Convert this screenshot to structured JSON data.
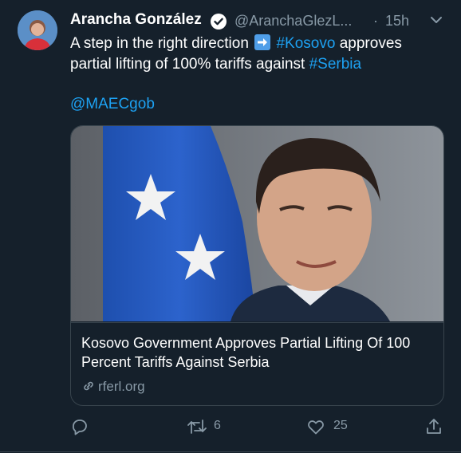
{
  "author": {
    "name": "Arancha González",
    "handle": "@AranchaGlezL...",
    "dot": "·",
    "time": "15h",
    "verified": true
  },
  "tweet": {
    "text_before": "A step in the right direction",
    "emoji": "right-arrow-emoji",
    "hashtag1": "#Kosovo",
    "text_middle": "approves partial lifting of 100% tariffs against",
    "hashtag2": "#Serbia",
    "mention": "@MAECgob"
  },
  "card": {
    "title": "Kosovo Government Approves Partial Lifting Of 100 Percent Tariffs Against Serbia",
    "domain": "rferl.org"
  },
  "actions": {
    "reply_count": "",
    "retweet_count": "6",
    "like_count": "25"
  },
  "colors": {
    "background": "#15202b",
    "link": "#1da1f2",
    "muted": "#8899a6",
    "border": "#38444d"
  }
}
